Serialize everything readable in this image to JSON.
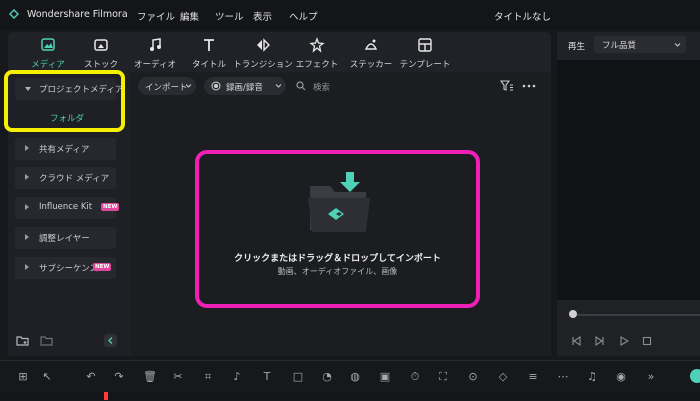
{
  "app": {
    "name": "Wondershare Filmora",
    "doc_title": "タイトルなし"
  },
  "menu": [
    "ファイル",
    "編集",
    "ツール",
    "表示",
    "ヘルプ"
  ],
  "tools": [
    {
      "label": "メディア",
      "icon": "media-icon",
      "active": true
    },
    {
      "label": "ストック",
      "icon": "stock-icon"
    },
    {
      "label": "オーディオ",
      "icon": "audio-icon"
    },
    {
      "label": "タイトル",
      "icon": "title-icon"
    },
    {
      "label": "トランジション",
      "icon": "transition-icon"
    },
    {
      "label": "エフェクト",
      "icon": "effect-icon"
    },
    {
      "label": "ステッカー",
      "icon": "sticker-icon"
    },
    {
      "label": "テンプレート",
      "icon": "template-icon"
    }
  ],
  "sidebar": {
    "items": [
      {
        "label": "プロジェクトメディア"
      },
      {
        "label": "共有メディア"
      },
      {
        "label": "クラウド メディア"
      },
      {
        "label": "Influence Kit",
        "badge": "NEW"
      },
      {
        "label": "調整レイヤー"
      },
      {
        "label": "サブシーケンス",
        "badge": "NEW"
      }
    ],
    "folder": "フォルダ"
  },
  "media_toolbar": {
    "import": "インポート",
    "record": "録画/録音",
    "search_placeholder": "検索"
  },
  "import_area": {
    "main": "クリックまたはドラッグ＆ドロップしてインポート",
    "sub": "動画、オーディオファイル、画像"
  },
  "preview": {
    "label": "再生",
    "quality": "フル品質"
  },
  "colors": {
    "accent": "#4fd1b8",
    "highlight_yellow": "#f6f000",
    "highlight_pink": "#f01fb8",
    "badge": "#e0479e"
  }
}
